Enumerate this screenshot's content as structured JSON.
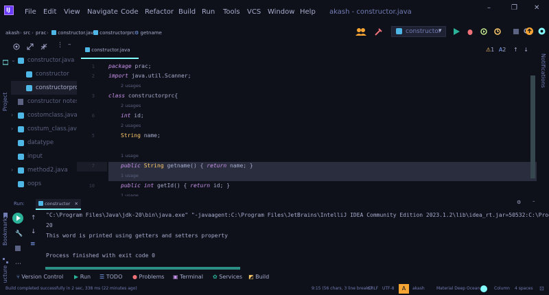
{
  "titlebar": {
    "menus": [
      "File",
      "Edit",
      "View",
      "Navigate",
      "Code",
      "Refactor",
      "Build",
      "Run",
      "Tools",
      "VCS",
      "Window",
      "Help"
    ],
    "window_title": "akash - constructor.java",
    "controls": [
      "–",
      "❐",
      "✕"
    ]
  },
  "breadcrumb": [
    "akash",
    "src",
    "prac",
    "constructor.java",
    "constructorprc",
    "getname"
  ],
  "run_config": "constructor",
  "project_panel": {
    "label": "Project",
    "items": [
      {
        "label": "constructor.java",
        "expanded": true
      },
      {
        "label": "constructor"
      },
      {
        "label": "constructorprc",
        "selected": true
      },
      {
        "label": "constructor notes"
      },
      {
        "label": "costomclass.java"
      },
      {
        "label": "costum_class.java"
      },
      {
        "label": "datatype"
      },
      {
        "label": "input"
      },
      {
        "label": "method2.java"
      },
      {
        "label": "oops"
      }
    ]
  },
  "editor": {
    "tab": "constructor.java",
    "warnings": "1",
    "weak_warnings": "2",
    "lines": [
      {
        "num": "1",
        "kind": "code",
        "text": "package prac;"
      },
      {
        "num": "2",
        "kind": "code",
        "text": "import java.util.Scanner;"
      },
      {
        "num": "",
        "kind": "hint",
        "text": "2 usages"
      },
      {
        "num": "3",
        "kind": "code",
        "text": "class constructorprc{"
      },
      {
        "num": "",
        "kind": "hint",
        "text": "2 usages"
      },
      {
        "num": "6",
        "kind": "code",
        "text": "int id;"
      },
      {
        "num": "",
        "kind": "hint",
        "text": "2 usages"
      },
      {
        "num": "5",
        "kind": "code",
        "text": "String name;"
      },
      {
        "num": "",
        "kind": "hint",
        "text": "1 usage"
      },
      {
        "num": "7",
        "kind": "code",
        "text": "public String getname() { return name; }"
      },
      {
        "num": "",
        "kind": "hint",
        "text": "1 usage"
      },
      {
        "num": "10",
        "kind": "code",
        "text": "public int getId() { return id; }"
      },
      {
        "num": "",
        "kind": "hint",
        "text": "1 usage"
      }
    ]
  },
  "run_panel": {
    "label": "Run:",
    "tab": "constructor",
    "output": [
      "\"C:\\Program Files\\Java\\jdk-20\\bin\\java.exe\" \"-javaagent:C:\\Program Files\\JetBrains\\IntelliJ IDEA Community Edition 2023.1.2\\lib\\idea_rt.jar=50532:C:\\Progra",
      "20",
      "This word is printed using getters and setters property",
      "",
      "Process finished with exit code 0"
    ]
  },
  "side_labels": {
    "bookmarks": "Bookmarks",
    "structure": "Structure",
    "notifications": "Notifications"
  },
  "tool_windows": [
    "Version Control",
    "Run",
    "TODO",
    "Problems",
    "Terminal",
    "Services",
    "Build"
  ],
  "statusbar": {
    "message": "Build completed successfully in 2 sec, 338 ms (22 minutes ago)",
    "position": "9:15 (56 chars, 3 line breaks)",
    "line_sep": "CRLF",
    "encoding": "UTF-8",
    "user_badge": "A",
    "user": "akash",
    "theme": "Material Deep Ocean",
    "column": "Column",
    "indent": "4 spaces"
  },
  "colors": {
    "accent": "#84ffff",
    "bg": "#0f111a",
    "keyword": "#c792ea",
    "type": "#ffcb6b",
    "run": "#2bb39a"
  }
}
